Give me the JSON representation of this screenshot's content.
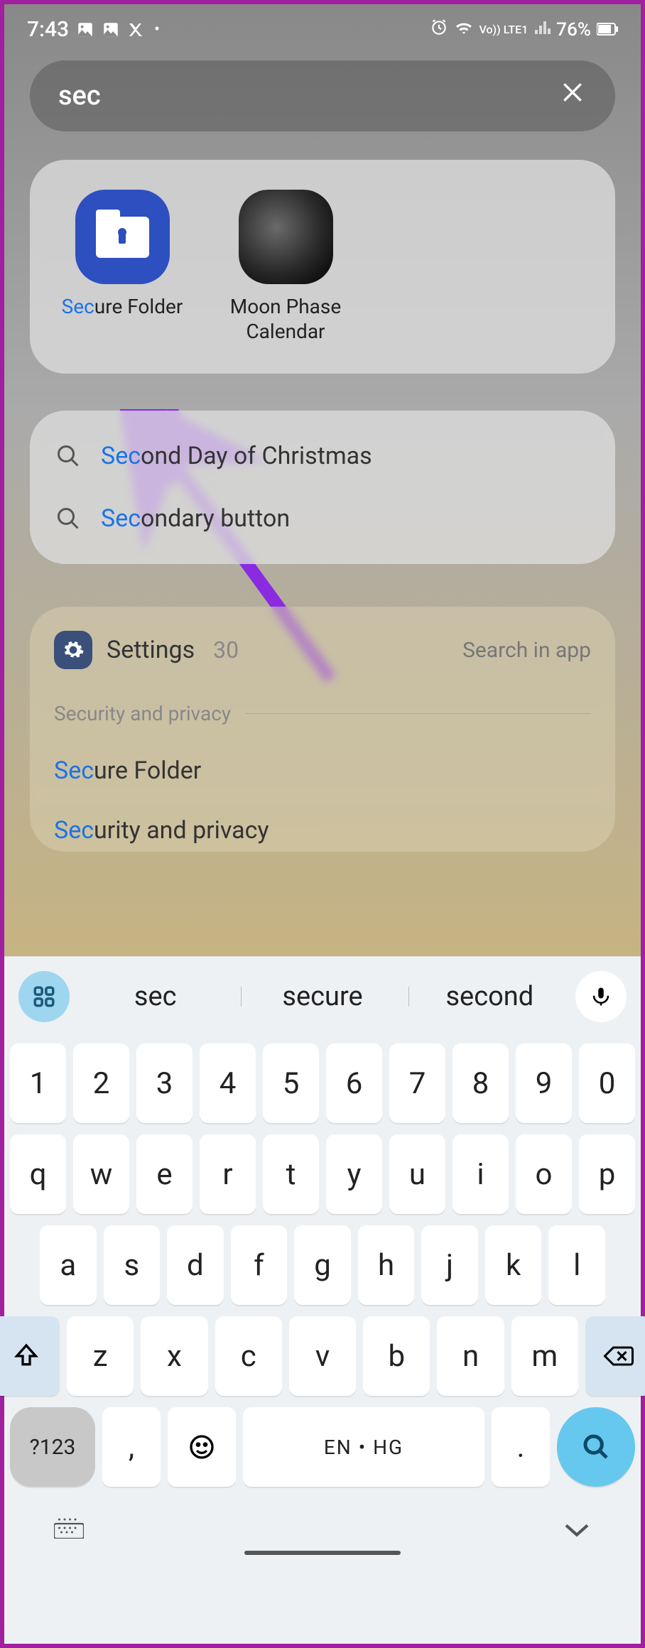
{
  "status_bar": {
    "time": "7:43",
    "battery_pct": "76%",
    "network_label": "Vo)) LTE1"
  },
  "search": {
    "query": "sec"
  },
  "app_results": [
    {
      "prefix": "Sec",
      "rest": "ure Folder",
      "icon": "secure-folder"
    },
    {
      "prefix": "",
      "rest": "Moon Phase Calendar",
      "icon": "moon"
    }
  ],
  "text_suggestions": [
    {
      "prefix": "Sec",
      "rest": "ond Day of Christmas"
    },
    {
      "prefix": "Sec",
      "rest": "ondary button"
    }
  ],
  "settings_card": {
    "title": "Settings",
    "count": "30",
    "search_in_app": "Search in app",
    "section": "Security and privacy",
    "items": [
      {
        "prefix": "Sec",
        "rest": "ure Folder"
      },
      {
        "prefix": "Sec",
        "rest": "urity and privacy"
      }
    ]
  },
  "keyboard": {
    "suggestions": [
      "sec",
      "secure",
      "second"
    ],
    "row_nums": [
      "1",
      "2",
      "3",
      "4",
      "5",
      "6",
      "7",
      "8",
      "9",
      "0"
    ],
    "row_top": [
      "q",
      "w",
      "e",
      "r",
      "t",
      "y",
      "u",
      "i",
      "o",
      "p"
    ],
    "row_mid": [
      "a",
      "s",
      "d",
      "f",
      "g",
      "h",
      "j",
      "k",
      "l"
    ],
    "row_bot": [
      "z",
      "x",
      "c",
      "v",
      "b",
      "n",
      "m"
    ],
    "symbols_key": "?123",
    "comma": ",",
    "period": ".",
    "space_label": "EN • HG"
  }
}
